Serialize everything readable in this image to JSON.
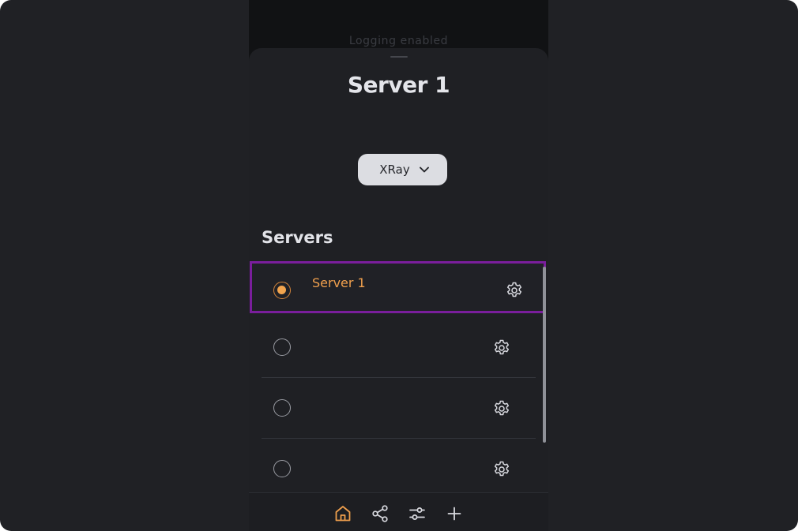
{
  "background_screen": {
    "status_text": "Logging enabled"
  },
  "sheet": {
    "title": "Server 1",
    "core_selector": {
      "selected": "XRay",
      "icon": "chevron-down-icon"
    },
    "servers_section": {
      "title": "Servers",
      "items": [
        {
          "label": "Server 1",
          "selected": true,
          "settings_icon": "gear-icon"
        },
        {
          "label": "",
          "selected": false,
          "settings_icon": "gear-icon"
        },
        {
          "label": "",
          "selected": false,
          "settings_icon": "gear-icon"
        },
        {
          "label": "",
          "selected": false,
          "settings_icon": "gear-icon"
        }
      ]
    }
  },
  "bottom_nav": {
    "items": [
      {
        "icon": "home-icon",
        "active": true
      },
      {
        "icon": "share-icon",
        "active": false
      },
      {
        "icon": "sliders-icon",
        "active": false
      },
      {
        "icon": "plus-icon",
        "active": false
      }
    ]
  },
  "colors": {
    "accent": "#ef9f4d",
    "selection_outline": "#7a1e9c",
    "sheet_background": "#1f2024",
    "outer_background": "#202125"
  }
}
